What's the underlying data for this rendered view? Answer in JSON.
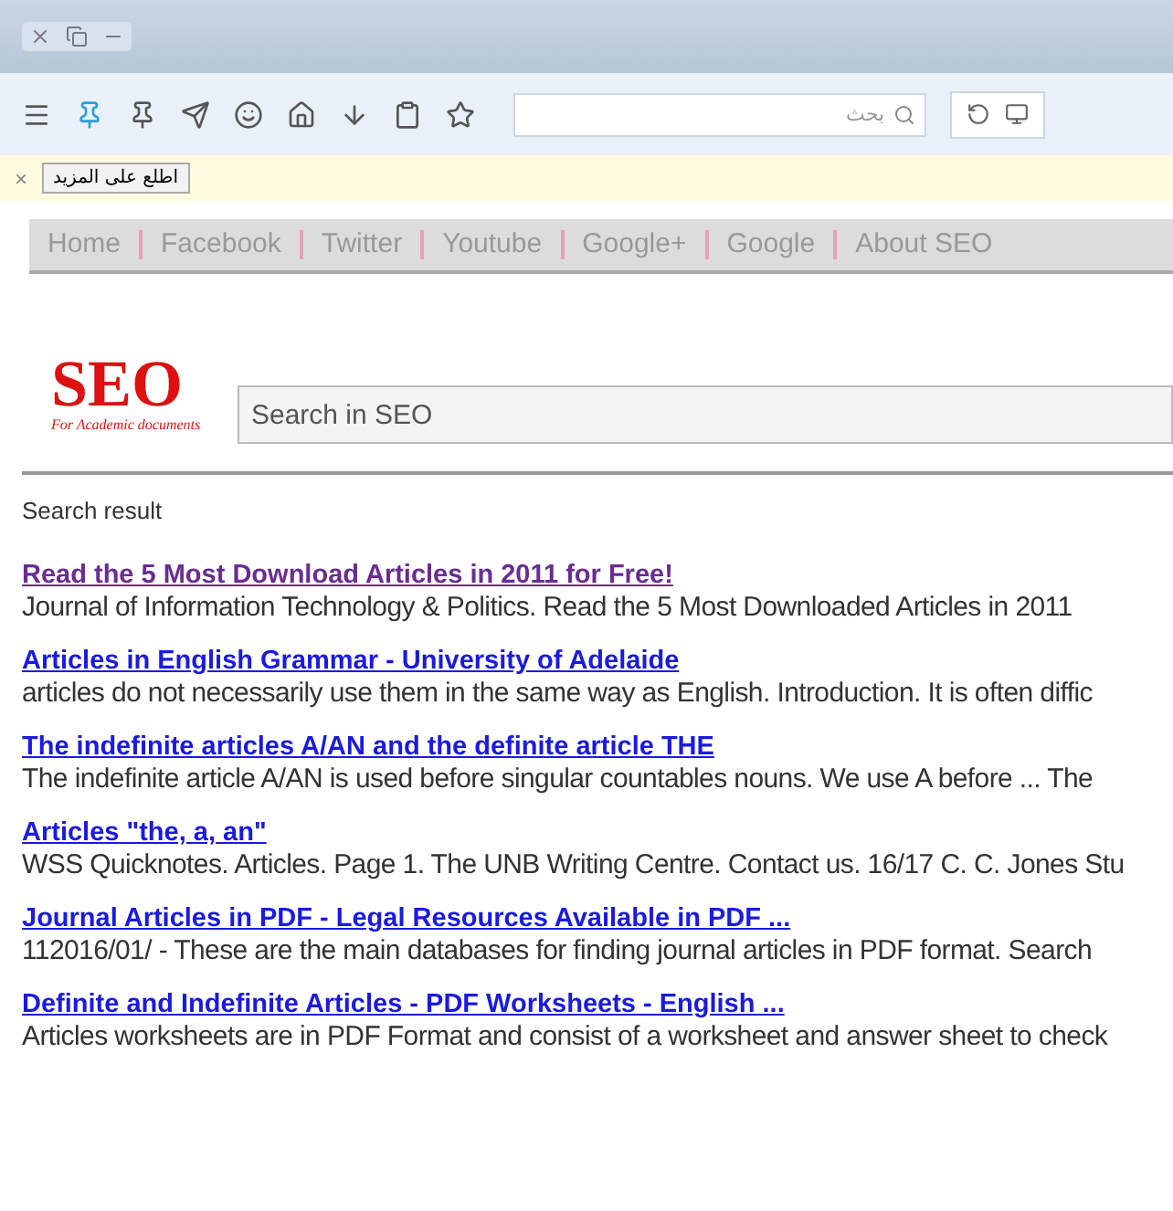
{
  "toolbar": {
    "address_placeholder": "بحث"
  },
  "notification": {
    "button": "اطلع على المزيد",
    "close": "×"
  },
  "nav": {
    "items": [
      "Home",
      "Facebook",
      "Twitter",
      "Youtube",
      "Google+",
      "Google",
      "About SEO"
    ]
  },
  "logo": {
    "title": "SEO",
    "tagline": "For Academic documents"
  },
  "search": {
    "placeholder": "Search in SEO"
  },
  "results_heading": "Search result",
  "results": [
    {
      "title": "Read the 5 Most Download Articles in 2011 for Free!",
      "snippet": "Journal of Information Technology & Politics. Read the 5 Most Downloaded Articles in 2011",
      "visited": true
    },
    {
      "title": "Articles in English Grammar - University of Adelaide",
      "snippet": "articles do not necessarily use them in the same way as English. Introduction. It is often diffic",
      "visited": false
    },
    {
      "title": "The indefinite articles A/AN and the definite article THE",
      "snippet": "The indefinite article A/AN is used before singular countables nouns. We use A before ... The",
      "visited": false
    },
    {
      "title": "Articles \"the, a, an\"",
      "snippet": "WSS Quicknotes. Articles. Page 1. The UNB Writing Centre. Contact us. 16/17 C. C. Jones Stu",
      "visited": false
    },
    {
      "title": "Journal Articles in PDF - Legal Resources Available in PDF ...",
      "snippet": "112016/01/ - These are the main databases for finding journal articles in PDF format. Search",
      "visited": false
    },
    {
      "title": "Definite and Indefinite Articles - PDF Worksheets - English ...",
      "snippet": "Articles worksheets are in PDF Format and consist of a worksheet and answer sheet to check",
      "visited": false
    }
  ]
}
